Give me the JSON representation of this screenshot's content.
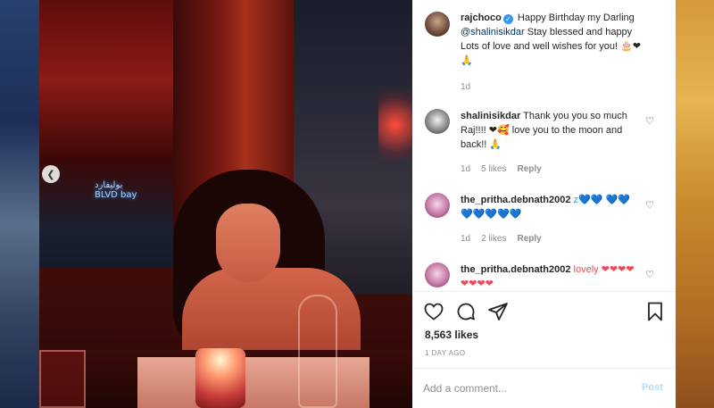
{
  "photo": {
    "sign_text": "بوليفارد\nBLVD bay",
    "prev_icon": "chevron-left-icon"
  },
  "caption": {
    "username": "rajchoco",
    "text_before": "Happy Birthday my Darling ",
    "mention": "@shalinisikdar",
    "text_after": " Stay blessed and happy Lots of love and well wishes for you! 🎂❤🙏",
    "age": "1d"
  },
  "comments": [
    {
      "username": "shalinisikdar",
      "text": "Thank you you so much Raj!!!! ❤🥰 love you to the moon and back!! 🙏",
      "age": "1d",
      "likes": "5 likes",
      "reply": "Reply"
    },
    {
      "username": "the_pritha.debnath2002",
      "text": "z💙💙 💙💙💙💙💙💙💙",
      "age": "1d",
      "likes": "2 likes",
      "reply": "Reply"
    },
    {
      "username": "the_pritha.debnath2002",
      "text": "lovely ❤❤❤❤❤❤❤❤",
      "age": "",
      "likes": "",
      "reply": ""
    }
  ],
  "actions": {
    "like_icon": "heart-icon",
    "comment_icon": "comment-icon",
    "share_icon": "paper-plane-icon",
    "save_icon": "bookmark-icon",
    "likes": "8,563 likes",
    "timestamp": "1 DAY AGO"
  },
  "add_comment": {
    "placeholder": "Add a comment...",
    "post_label": "Post"
  },
  "colors": {
    "link": "#00376b",
    "verified": "#3897f0",
    "muted": "#8e8e8e",
    "post_disabled": "#b2dffc"
  }
}
